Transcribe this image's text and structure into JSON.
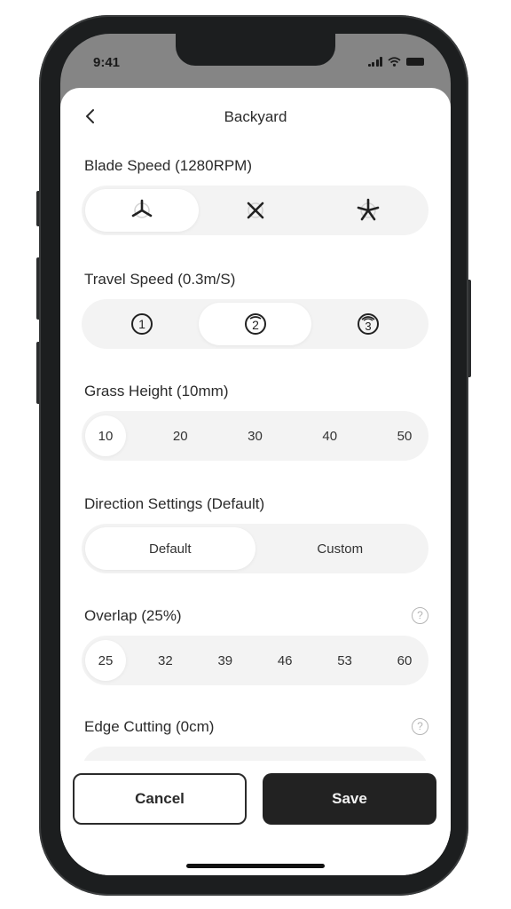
{
  "status_bar": {
    "time": "9:41",
    "icons": [
      "signal-icon",
      "wifi-icon",
      "battery-icon"
    ]
  },
  "header": {
    "title": "Backyard",
    "back_icon": "chevron-left-icon"
  },
  "blade_speed": {
    "label": "Blade Speed (1280RPM)",
    "options": [
      {
        "icon": "three-blade-fan-icon",
        "active": true
      },
      {
        "icon": "four-blade-fan-icon",
        "active": false
      },
      {
        "icon": "five-blade-fan-icon",
        "active": false
      }
    ]
  },
  "travel_speed": {
    "label": "Travel Speed (0.3m/S)",
    "options": [
      {
        "icon": "speed-level-1-icon",
        "value": "1",
        "active": false
      },
      {
        "icon": "speed-level-2-icon",
        "value": "2",
        "active": true
      },
      {
        "icon": "speed-level-3-icon",
        "value": "3",
        "active": false
      }
    ]
  },
  "grass_height": {
    "label": "Grass Height (10mm)",
    "options": [
      "10",
      "20",
      "30",
      "40",
      "50"
    ],
    "selected": "10"
  },
  "direction": {
    "label": "Direction Settings (Default)",
    "options": [
      "Default",
      "Custom"
    ],
    "selected": "Default"
  },
  "overlap": {
    "label": "Overlap (25%)",
    "help": "?",
    "options": [
      "25",
      "32",
      "39",
      "46",
      "53",
      "60"
    ],
    "selected": "25"
  },
  "edge_cutting": {
    "label": "Edge Cutting (0cm)",
    "help": "?"
  },
  "footer": {
    "cancel_label": "Cancel",
    "save_label": "Save"
  }
}
